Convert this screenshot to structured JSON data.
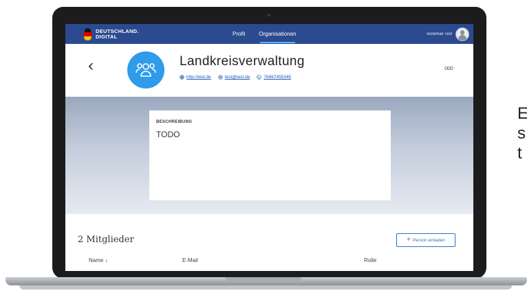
{
  "nav": {
    "logo_line1": "DEUTSCHLAND.",
    "logo_line2": "DIGITAL",
    "items": [
      {
        "label": "Profil",
        "active": false
      },
      {
        "label": "Organisationen",
        "active": true
      }
    ],
    "user_name": "Testemail Test"
  },
  "org": {
    "title": "Landkreisverwaltung",
    "links": [
      {
        "icon": "globe-icon",
        "text": "http://test.de"
      },
      {
        "icon": "at-icon",
        "text": "test@test.de"
      },
      {
        "icon": "phone-icon",
        "text": "76967455345"
      }
    ],
    "more_icon": "more-dots-icon"
  },
  "description": {
    "label": "BESCHREIBUNG",
    "text": "TODO"
  },
  "members": {
    "title": "2 Mitglieder",
    "invite_label": "Person einladen",
    "columns": {
      "name": "Name ↓",
      "email": "E-Mail",
      "role": "Rolle"
    }
  },
  "side_text": [
    "E",
    "s",
    "t"
  ],
  "colors": {
    "nav_bg": "#2b4a8f",
    "accent": "#2f9bea",
    "link": "#1a55b3"
  }
}
